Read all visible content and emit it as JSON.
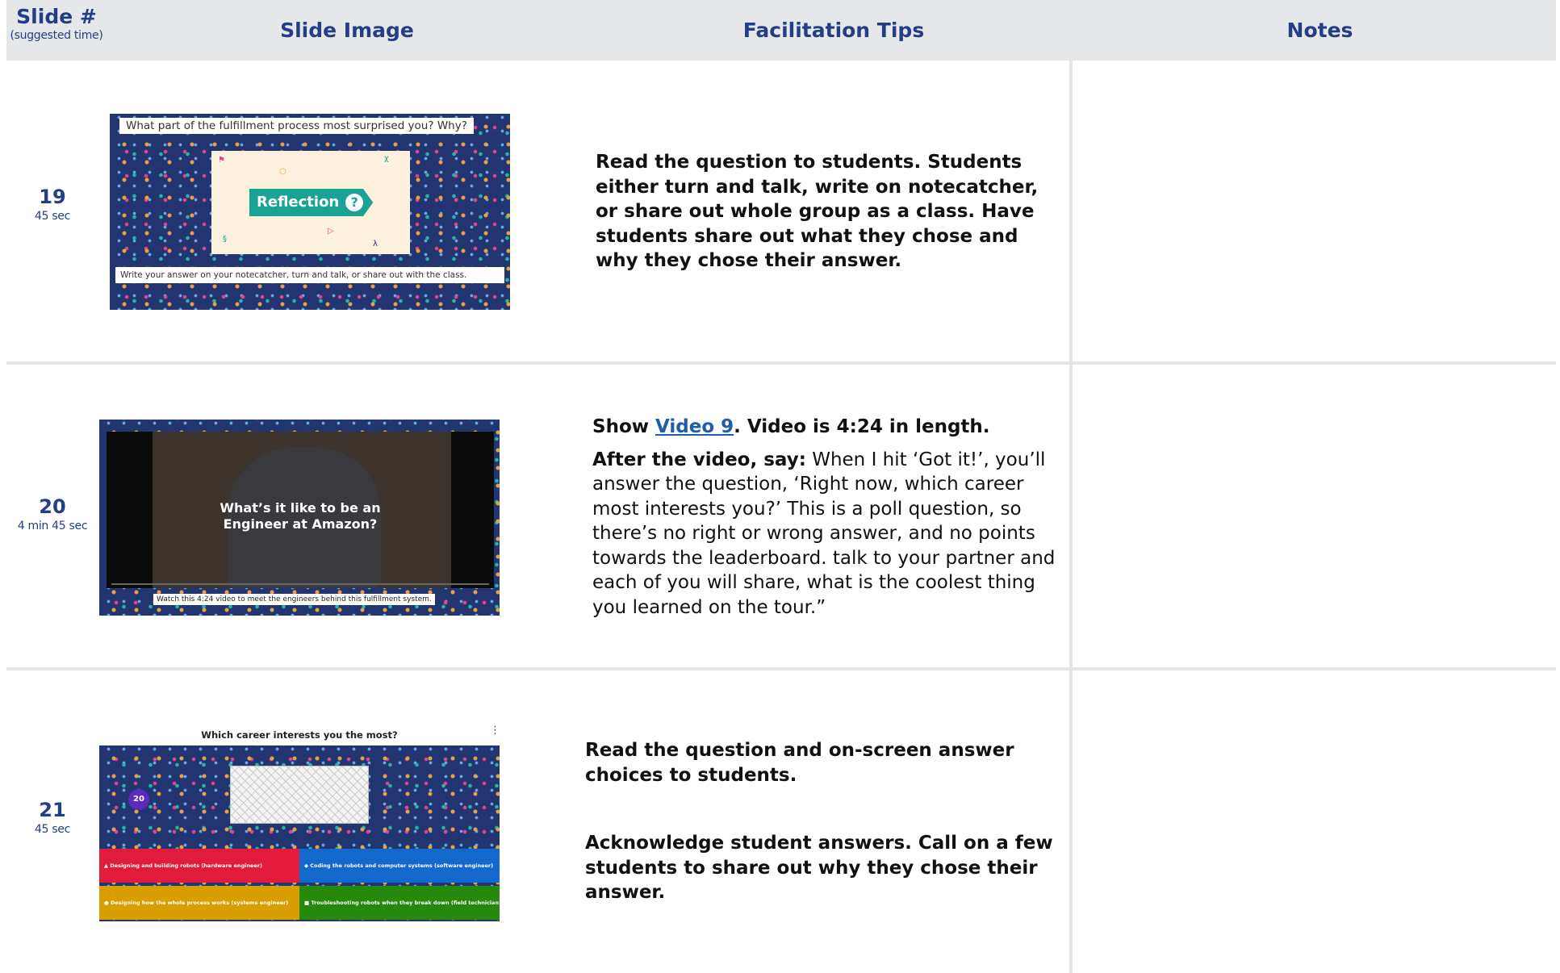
{
  "header": {
    "slide_label": "Slide #",
    "slide_sub": "(suggested time)",
    "image_label": "Slide Image",
    "tips_label": "Facilitation Tips",
    "notes_label": "Notes"
  },
  "colors": {
    "header_text": "#223e86",
    "header_bg": "#e6e7e9",
    "link": "#1f5fa8"
  },
  "rows": [
    {
      "num": "19",
      "time": "45 sec",
      "slide": {
        "question": "What part of the fulfillment process most surprised you? Why?",
        "badge": "Reflection",
        "badge_icon": "?",
        "answer_prompt": "Write your answer on your notecatcher, turn and talk, or share out with the class."
      },
      "tip": "Read the question to students. Students either turn and talk, write on notecatcher, or share out whole group as a class. Have students share out what they chose and why they chose their answer."
    },
    {
      "num": "20",
      "time": "4 min 45 sec",
      "slide": {
        "video_title": "What’s it like to be an Engineer at Amazon?",
        "caption": "Watch this 4:24 video to meet the engineers behind this fulfillment system."
      },
      "tip_show": "Show ",
      "tip_link": "Video 9",
      "tip_length": ". Video is 4:24 in length.",
      "tip_after_label": "After the video, say:",
      "tip_after_text": " When I hit ‘Got it!’, you’ll answer the question, ‘Right now, which career most interests you?’ This is a poll question, so there’s no right or wrong answer, and no points towards the leaderboard. talk to your partner and each of you will share, what is the coolest thing you learned on the tour.”"
    },
    {
      "num": "21",
      "time": "45 sec",
      "slide": {
        "question": "Which career interests you the most?",
        "timer": "20",
        "answers": [
          {
            "text": "Designing and building robots (hardware engineer)",
            "color": "#e21b3c",
            "icon": "▲"
          },
          {
            "text": "Coding the robots and computer systems (software engineer)",
            "color": "#1368ce",
            "icon": "◆"
          },
          {
            "text": "Designing how the whole process works (systems engineer)",
            "color": "#d89e00",
            "icon": "●"
          },
          {
            "text": "Troubleshooting robots when they break down (field technician)",
            "color": "#26890c",
            "icon": "■"
          }
        ]
      },
      "tip1": "Read the question and on-screen answer choices to students.",
      "tip2": "Acknowledge student answers. Call on a few students to share out why they chose their answer."
    }
  ]
}
